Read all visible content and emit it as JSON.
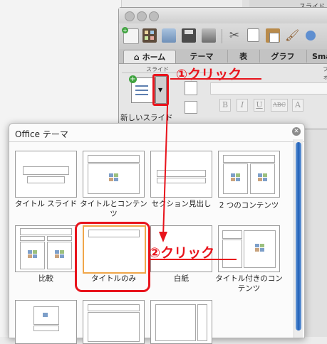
{
  "background": {
    "top_right_text": "スライド"
  },
  "window": {
    "tabs": [
      {
        "label": "ホーム",
        "icon": "home-icon"
      },
      {
        "label": "テーマ"
      },
      {
        "label": "表"
      },
      {
        "label": "グラフ"
      },
      {
        "label": "Sma"
      }
    ],
    "toolbar_icons": [
      "new-document-icon",
      "gallery-icon",
      "open-icon",
      "save-icon",
      "print-icon",
      "cut-icon",
      "copy-icon",
      "paste-icon",
      "format-brush-icon"
    ],
    "ribbon": {
      "group_slides_label": "スライド",
      "group_font_label": "フォ",
      "new_slide_label": "新しいスライド",
      "format_buttons": [
        "B",
        "I",
        "U",
        "ABC",
        "A"
      ]
    }
  },
  "gallery": {
    "title": "Office テーマ",
    "layouts": [
      {
        "name": "タイトル スライド"
      },
      {
        "name": "タイトルとコンテンツ"
      },
      {
        "name": "セクション見出し"
      },
      {
        "name": "2 つのコンテンツ"
      },
      {
        "name": "比較"
      },
      {
        "name": "タイトルのみ"
      },
      {
        "name": "白紙"
      },
      {
        "name": "タイトル付きのコンテンツ"
      }
    ]
  },
  "annotations": {
    "step1": "①クリック",
    "step2": "②クリック",
    "color": "#e8141c"
  }
}
